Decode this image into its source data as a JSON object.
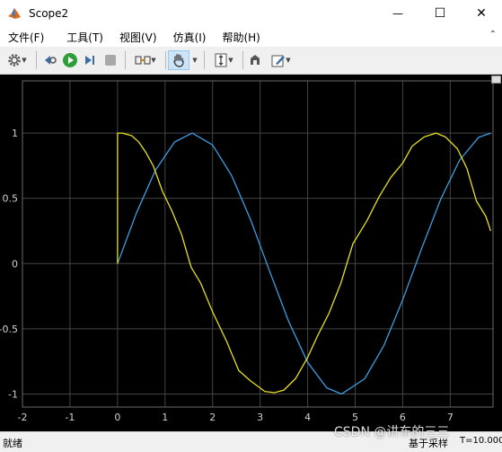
{
  "window": {
    "title": "Scope2",
    "minimize_glyph": "—",
    "maximize_glyph": "☐",
    "close_glyph": "✕"
  },
  "menu": {
    "items": [
      "文件(F)",
      "工具(T)",
      "视图(V)",
      "仿真(I)",
      "帮助(H)"
    ]
  },
  "toolbar": {
    "buttons": [
      "settings-icon",
      "step-back-icon",
      "run-icon",
      "step-forward-icon",
      "stop-icon",
      "highlight-signal-icon",
      "pan-icon",
      "scale-axes-icon",
      "restore-icon",
      "edit-icon"
    ]
  },
  "colors": {
    "series1": "#3d9ee0",
    "series2": "#e6e020",
    "background": "#000000",
    "grid": "#444444",
    "tick_text": "#d0d0d0"
  },
  "chart_data": {
    "type": "line",
    "title": "",
    "xlabel": "",
    "ylabel": "",
    "xlim": [
      -2,
      7.9
    ],
    "ylim": [
      -1.1,
      1.4
    ],
    "x_ticks": [
      "-2",
      "-1",
      "0",
      "1",
      "2",
      "3",
      "4",
      "5",
      "6",
      "7"
    ],
    "x_tick_values": [
      -2,
      -1,
      0,
      1,
      2,
      3,
      4,
      5,
      6,
      7
    ],
    "y_ticks": [
      "1",
      "0.5",
      "0",
      "-0.5",
      "-1"
    ],
    "y_tick_values": [
      1,
      0.5,
      0,
      -0.5,
      -1
    ],
    "grid": true,
    "series": [
      {
        "color": "#3d9ee0",
        "x": [
          0,
          0.4,
          0.8,
          1.2,
          1.571,
          2.0,
          2.4,
          2.8,
          3.2,
          3.6,
          4.0,
          4.4,
          4.712,
          5.2,
          5.6,
          6.0,
          6.4,
          6.8,
          7.2,
          7.6,
          7.85
        ],
        "y": [
          0,
          0.389,
          0.717,
          0.932,
          1.0,
          0.909,
          0.675,
          0.335,
          -0.058,
          -0.443,
          -0.757,
          -0.952,
          -1.0,
          -0.883,
          -0.631,
          -0.279,
          0.117,
          0.494,
          0.794,
          0.968,
          1.0
        ]
      },
      {
        "color": "#e6e020",
        "x": [
          0,
          0,
          0.1,
          0.3,
          0.45,
          0.6,
          0.75,
          0.95,
          1.15,
          1.35,
          1.55,
          1.75,
          2.0,
          2.3,
          2.55,
          2.8,
          3.1,
          3.3,
          3.5,
          3.75,
          4.0,
          4.2,
          4.45,
          4.7,
          4.95,
          5.25,
          5.5,
          5.75,
          6.0,
          6.2,
          6.45,
          6.7,
          6.9,
          7.15,
          7.35,
          7.55,
          7.75,
          7.85
        ],
        "y": [
          0,
          1.0,
          1.0,
          0.98,
          0.93,
          0.85,
          0.75,
          0.55,
          0.4,
          0.22,
          -0.03,
          -0.15,
          -0.37,
          -0.6,
          -0.82,
          -0.9,
          -0.98,
          -0.99,
          -0.97,
          -0.88,
          -0.72,
          -0.56,
          -0.38,
          -0.15,
          0.15,
          0.33,
          0.51,
          0.66,
          0.77,
          0.9,
          0.97,
          1.0,
          0.97,
          0.88,
          0.73,
          0.48,
          0.36,
          0.25
        ]
      }
    ]
  },
  "status": {
    "text": "就绪",
    "sample": "基于采样",
    "time": "T=10.000"
  },
  "watermark": "CSDN @讲东的三三"
}
